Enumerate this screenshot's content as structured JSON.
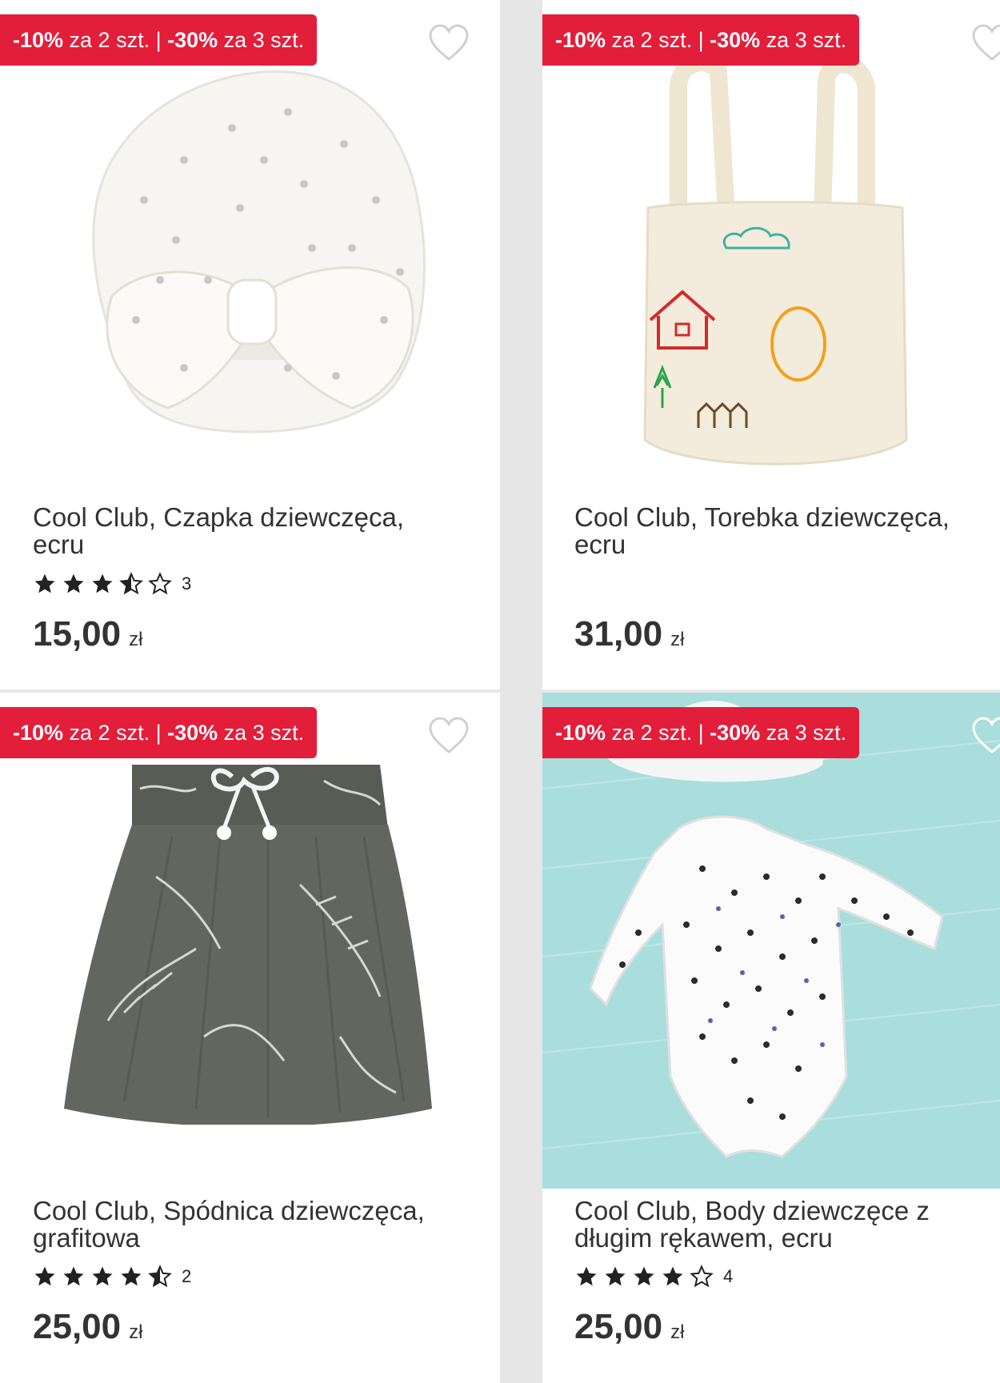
{
  "products": [
    {
      "promo_part1": "-10%",
      "promo_part2": " za 2 szt. | ",
      "promo_part3": "-30%",
      "promo_part4": " za 3 szt.",
      "title_line1": "Cool Club, Czapka dziewczęca,",
      "title_line2": "ecru",
      "rating": 3.5,
      "rating_count": "3",
      "price": "15,00",
      "currency": "zł",
      "image": "turban-hat-image"
    },
    {
      "promo_part1": "-10%",
      "promo_part2": " za 2 szt. | ",
      "promo_part3": "-30%",
      "promo_part4": " za 3 szt.",
      "title_line1": "Cool Club, Torebka dziewczęca,",
      "title_line2": "ecru",
      "rating": null,
      "rating_count": "",
      "price": "31,00",
      "currency": "zł",
      "image": "tote-bag-image"
    },
    {
      "promo_part1": "-10%",
      "promo_part2": " za 2 szt. | ",
      "promo_part3": "-30%",
      "promo_part4": " za 3 szt.",
      "title_line1": "Cool Club, Spódnica dziewczęca,",
      "title_line2": "grafitowa",
      "rating": 4.5,
      "rating_count": "2",
      "price": "25,00",
      "currency": "zł",
      "image": "skirt-image"
    },
    {
      "promo_part1": "-10%",
      "promo_part2": " za 2 szt. | ",
      "promo_part3": "-30%",
      "promo_part4": " za 3 szt.",
      "title_line1": "Cool Club, Body dziewczęce z",
      "title_line2": "długim rękawem, ecru",
      "rating": 4,
      "rating_count": "4",
      "price": "25,00",
      "currency": "zł",
      "image": "bodysuit-image"
    }
  ],
  "colors": {
    "promo_bg": "#e31e3a",
    "text": "#333333",
    "star": "#222222"
  },
  "icons": [
    "heart-outline-icon",
    "star-full-icon",
    "star-half-icon",
    "star-empty-icon"
  ]
}
